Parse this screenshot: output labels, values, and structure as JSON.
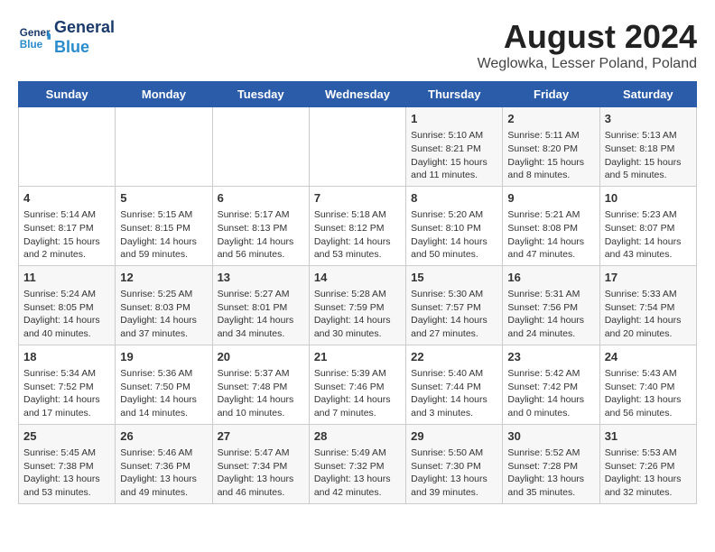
{
  "header": {
    "logo_line1": "General",
    "logo_line2": "Blue",
    "title": "August 2024",
    "subtitle": "Weglowka, Lesser Poland, Poland"
  },
  "days_of_week": [
    "Sunday",
    "Monday",
    "Tuesday",
    "Wednesday",
    "Thursday",
    "Friday",
    "Saturday"
  ],
  "weeks": [
    [
      {
        "day": "",
        "content": ""
      },
      {
        "day": "",
        "content": ""
      },
      {
        "day": "",
        "content": ""
      },
      {
        "day": "",
        "content": ""
      },
      {
        "day": "1",
        "content": "Sunrise: 5:10 AM\nSunset: 8:21 PM\nDaylight: 15 hours\nand 11 minutes."
      },
      {
        "day": "2",
        "content": "Sunrise: 5:11 AM\nSunset: 8:20 PM\nDaylight: 15 hours\nand 8 minutes."
      },
      {
        "day": "3",
        "content": "Sunrise: 5:13 AM\nSunset: 8:18 PM\nDaylight: 15 hours\nand 5 minutes."
      }
    ],
    [
      {
        "day": "4",
        "content": "Sunrise: 5:14 AM\nSunset: 8:17 PM\nDaylight: 15 hours\nand 2 minutes."
      },
      {
        "day": "5",
        "content": "Sunrise: 5:15 AM\nSunset: 8:15 PM\nDaylight: 14 hours\nand 59 minutes."
      },
      {
        "day": "6",
        "content": "Sunrise: 5:17 AM\nSunset: 8:13 PM\nDaylight: 14 hours\nand 56 minutes."
      },
      {
        "day": "7",
        "content": "Sunrise: 5:18 AM\nSunset: 8:12 PM\nDaylight: 14 hours\nand 53 minutes."
      },
      {
        "day": "8",
        "content": "Sunrise: 5:20 AM\nSunset: 8:10 PM\nDaylight: 14 hours\nand 50 minutes."
      },
      {
        "day": "9",
        "content": "Sunrise: 5:21 AM\nSunset: 8:08 PM\nDaylight: 14 hours\nand 47 minutes."
      },
      {
        "day": "10",
        "content": "Sunrise: 5:23 AM\nSunset: 8:07 PM\nDaylight: 14 hours\nand 43 minutes."
      }
    ],
    [
      {
        "day": "11",
        "content": "Sunrise: 5:24 AM\nSunset: 8:05 PM\nDaylight: 14 hours\nand 40 minutes."
      },
      {
        "day": "12",
        "content": "Sunrise: 5:25 AM\nSunset: 8:03 PM\nDaylight: 14 hours\nand 37 minutes."
      },
      {
        "day": "13",
        "content": "Sunrise: 5:27 AM\nSunset: 8:01 PM\nDaylight: 14 hours\nand 34 minutes."
      },
      {
        "day": "14",
        "content": "Sunrise: 5:28 AM\nSunset: 7:59 PM\nDaylight: 14 hours\nand 30 minutes."
      },
      {
        "day": "15",
        "content": "Sunrise: 5:30 AM\nSunset: 7:57 PM\nDaylight: 14 hours\nand 27 minutes."
      },
      {
        "day": "16",
        "content": "Sunrise: 5:31 AM\nSunset: 7:56 PM\nDaylight: 14 hours\nand 24 minutes."
      },
      {
        "day": "17",
        "content": "Sunrise: 5:33 AM\nSunset: 7:54 PM\nDaylight: 14 hours\nand 20 minutes."
      }
    ],
    [
      {
        "day": "18",
        "content": "Sunrise: 5:34 AM\nSunset: 7:52 PM\nDaylight: 14 hours\nand 17 minutes."
      },
      {
        "day": "19",
        "content": "Sunrise: 5:36 AM\nSunset: 7:50 PM\nDaylight: 14 hours\nand 14 minutes."
      },
      {
        "day": "20",
        "content": "Sunrise: 5:37 AM\nSunset: 7:48 PM\nDaylight: 14 hours\nand 10 minutes."
      },
      {
        "day": "21",
        "content": "Sunrise: 5:39 AM\nSunset: 7:46 PM\nDaylight: 14 hours\nand 7 minutes."
      },
      {
        "day": "22",
        "content": "Sunrise: 5:40 AM\nSunset: 7:44 PM\nDaylight: 14 hours\nand 3 minutes."
      },
      {
        "day": "23",
        "content": "Sunrise: 5:42 AM\nSunset: 7:42 PM\nDaylight: 14 hours\nand 0 minutes."
      },
      {
        "day": "24",
        "content": "Sunrise: 5:43 AM\nSunset: 7:40 PM\nDaylight: 13 hours\nand 56 minutes."
      }
    ],
    [
      {
        "day": "25",
        "content": "Sunrise: 5:45 AM\nSunset: 7:38 PM\nDaylight: 13 hours\nand 53 minutes."
      },
      {
        "day": "26",
        "content": "Sunrise: 5:46 AM\nSunset: 7:36 PM\nDaylight: 13 hours\nand 49 minutes."
      },
      {
        "day": "27",
        "content": "Sunrise: 5:47 AM\nSunset: 7:34 PM\nDaylight: 13 hours\nand 46 minutes."
      },
      {
        "day": "28",
        "content": "Sunrise: 5:49 AM\nSunset: 7:32 PM\nDaylight: 13 hours\nand 42 minutes."
      },
      {
        "day": "29",
        "content": "Sunrise: 5:50 AM\nSunset: 7:30 PM\nDaylight: 13 hours\nand 39 minutes."
      },
      {
        "day": "30",
        "content": "Sunrise: 5:52 AM\nSunset: 7:28 PM\nDaylight: 13 hours\nand 35 minutes."
      },
      {
        "day": "31",
        "content": "Sunrise: 5:53 AM\nSunset: 7:26 PM\nDaylight: 13 hours\nand 32 minutes."
      }
    ]
  ]
}
